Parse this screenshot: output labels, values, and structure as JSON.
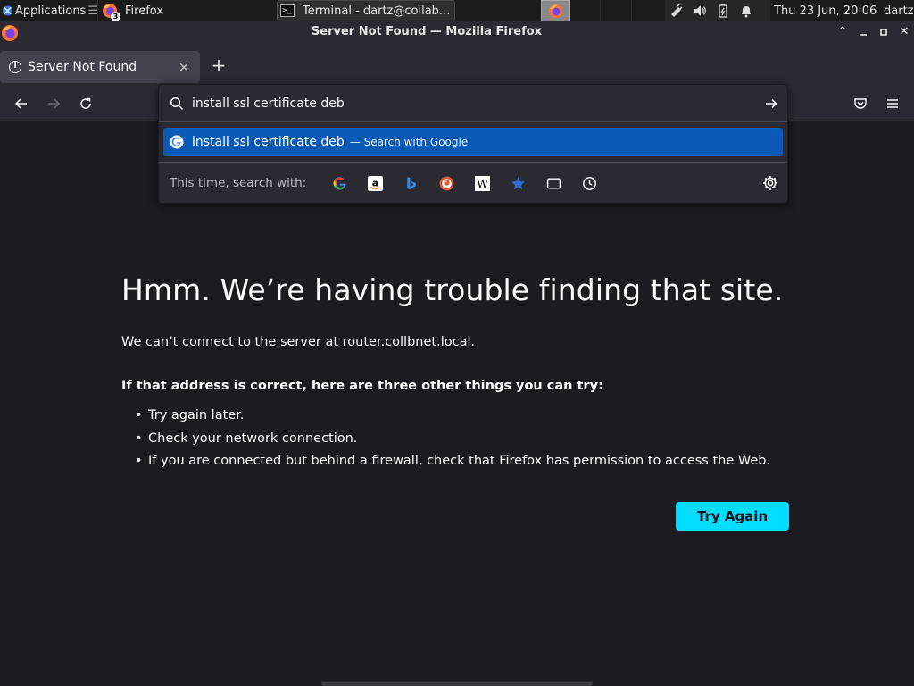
{
  "panel": {
    "applications_label": "Applications",
    "firefox_task_label": "Firefox",
    "firefox_task_badge": "3",
    "terminal_task_label": "Terminal - dartz@collab...",
    "terminal_icon_text": ">_",
    "clock": "Thu 23 Jun, 20:06",
    "user": "dartz"
  },
  "window": {
    "title": "Server Not Found — Mozilla Firefox",
    "minimize": "⌃",
    "restore": "—",
    "maximize": "□",
    "close": "✕"
  },
  "tabs": [
    {
      "label": "Server Not Found",
      "icon": "info-icon",
      "active": true
    }
  ],
  "tab_close": "×",
  "new_tab": "+",
  "urlbar": {
    "value": "install ssl certificate deb",
    "suggestion_text": "install ssl certificate deb",
    "suggestion_action": "— Search with Google",
    "oneoff_label": "This time, search with:",
    "engines": [
      "google",
      "amazon",
      "bing",
      "duckduckgo",
      "wikipedia",
      "bookmarks",
      "tabs",
      "history"
    ]
  },
  "error": {
    "title": "Hmm. We’re having trouble finding that site.",
    "description": "We can’t connect to the server at router.collbnet.local.",
    "suggestions_heading": "If that address is correct, here are three other things you can try:",
    "suggestions": [
      "Try again later.",
      "Check your network connection.",
      "If you are connected but behind a firewall, check that Firefox has permission to access the Web."
    ],
    "try_again_label": "Try Again"
  },
  "colors": {
    "page_bg": "#1c1b22",
    "toolbar_bg": "#2b2a33",
    "accent_button": "#00ddff",
    "selected_suggestion": "#0a5ab6"
  }
}
